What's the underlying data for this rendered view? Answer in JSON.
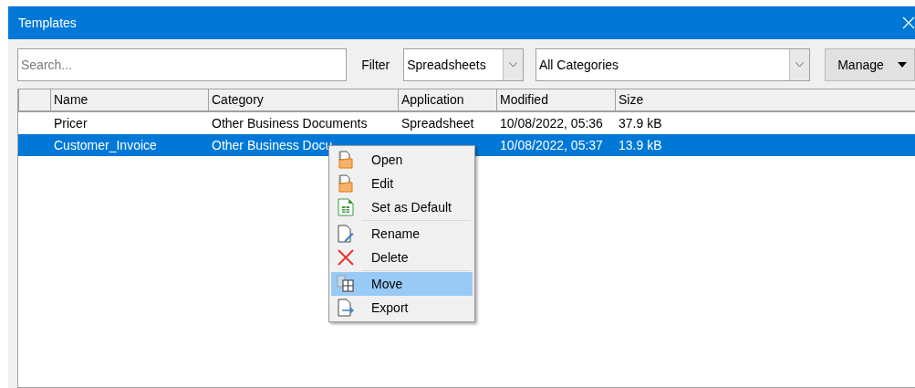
{
  "window": {
    "title": "Templates"
  },
  "search": {
    "placeholder": "Search..."
  },
  "filter": {
    "label": "Filter",
    "application": "Spreadsheets",
    "category": "All Categories"
  },
  "manage_button": {
    "label": "Manage"
  },
  "table": {
    "columns": [
      "Name",
      "Category",
      "Application",
      "Modified",
      "Size"
    ],
    "rows": [
      {
        "selected": false,
        "name": "Pricer",
        "category": "Other Business Documents",
        "application": "Spreadsheet",
        "modified": "10/08/2022, 05:36",
        "size": "37.9 kB"
      },
      {
        "selected": true,
        "name": "Customer_Invoice",
        "category": "Other Business Docu",
        "modified": "10/08/2022, 05:37",
        "size": "13.9 kB"
      }
    ]
  },
  "context_menu": {
    "items": [
      {
        "kind": "open",
        "label": "Open",
        "selected": false,
        "separator_after": false
      },
      {
        "kind": "edit",
        "label": "Edit",
        "selected": false,
        "separator_after": false
      },
      {
        "kind": "default",
        "label": "Set as Default",
        "selected": false,
        "separator_after": true
      },
      {
        "kind": "rename",
        "label": "Rename",
        "selected": false,
        "separator_after": false
      },
      {
        "kind": "delete",
        "label": "Delete",
        "selected": false,
        "separator_after": true
      },
      {
        "kind": "move",
        "label": "Move",
        "selected": true,
        "separator_after": false
      },
      {
        "kind": "export",
        "label": "Export",
        "selected": false,
        "separator_after": false
      }
    ]
  }
}
